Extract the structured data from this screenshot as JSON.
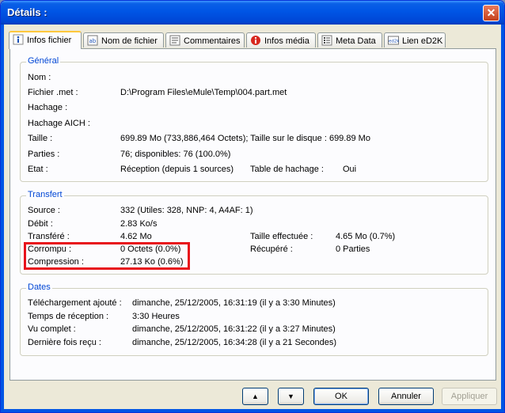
{
  "window": {
    "title": "Détails :"
  },
  "tabs": [
    "Infos fichier",
    "Nom de fichier",
    "Commentaires",
    "Infos média",
    "Meta Data",
    "Lien eD2K"
  ],
  "general": {
    "title": "Général",
    "rows": [
      {
        "label": "Nom :",
        "value": ""
      },
      {
        "label": "Fichier .met :",
        "value": "D:\\Program Files\\eMule\\Temp\\004.part.met"
      },
      {
        "label": "Hachage :",
        "value": ""
      },
      {
        "label": "Hachage AICH :",
        "value": ""
      },
      {
        "label": "Taille :",
        "value": "699.89 Mo  (733,886,464 Octets);  Taille sur le disque :  699.89 Mo"
      },
      {
        "label": "Parties :",
        "value": "76;  disponibles: 76 (100.0%)"
      },
      {
        "label": "Etat :",
        "value": "Réception (depuis 1 sources)"
      }
    ],
    "hash_table_label": "Table de hachage :",
    "hash_table_value": "Oui"
  },
  "transfer": {
    "title": "Transfert",
    "rows": [
      {
        "label": "Source :",
        "value": "332  (Utiles: 328, NNP: 4, A4AF: 1)"
      },
      {
        "label": "Débit :",
        "value": "2.83 Ko/s"
      },
      {
        "label": "Transféré :",
        "value": "4.62 Mo"
      },
      {
        "label": "Corrompu :",
        "value": "0 Octets (0.0%)"
      },
      {
        "label": "Compression :",
        "value": "27.13 Ko (0.6%)"
      }
    ],
    "size_done_label": "Taille effectuée :",
    "size_done_value": "4.65 Mo (0.7%)",
    "recovered_label": "Récupéré :",
    "recovered_value": "0 Parties"
  },
  "dates": {
    "title": "Dates",
    "rows": [
      {
        "label": "Téléchargement ajouté :",
        "value": "dimanche, 25/12/2005, 16:31:19  (il y a 3:30 Minutes)"
      },
      {
        "label": "Temps de réception :",
        "value": "3:30 Heures"
      },
      {
        "label": "Vu complet :",
        "value": "dimanche, 25/12/2005, 16:31:22  (il y a 3:27 Minutes)"
      },
      {
        "label": "Dernière fois reçu :",
        "value": "dimanche, 25/12/2005, 16:34:28  (il y a 21 Secondes)"
      }
    ]
  },
  "buttons": {
    "up": "▲",
    "down": "▼",
    "ok": "OK",
    "cancel": "Annuler",
    "apply": "Appliquer"
  },
  "colors": {
    "highlight": "#e8131b",
    "group_title": "#0046d5",
    "title_bar": "#0055e5"
  }
}
